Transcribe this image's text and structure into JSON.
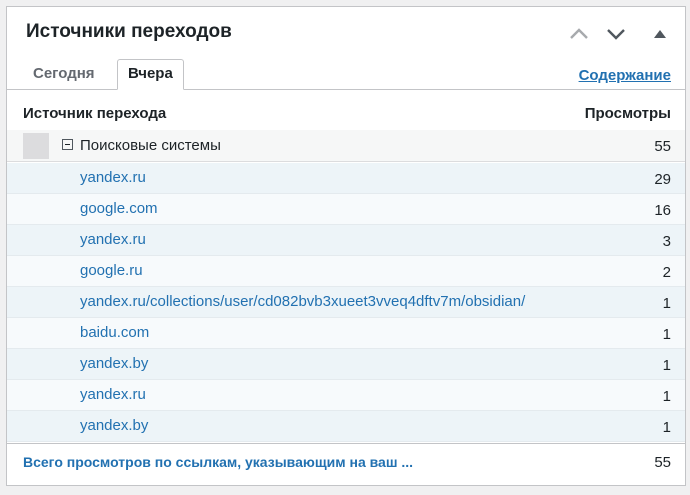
{
  "widget": {
    "title": "Источники переходов",
    "controls": {
      "up_icon": "chevron-up-icon",
      "down_icon": "chevron-down-icon",
      "collapse_icon": "triangle-up-icon"
    }
  },
  "tabs": {
    "today": "Сегодня",
    "yesterday": "Вчера",
    "active": "yesterday"
  },
  "contents_link": "Содержание",
  "table": {
    "columns": {
      "source": "Источник перехода",
      "views": "Просмотры"
    },
    "group": {
      "label": "Поисковые системы",
      "count": "55",
      "toggle_icon": "minus-box-icon"
    },
    "rows": [
      {
        "url": "yandex.ru",
        "count": "29"
      },
      {
        "url": "google.com",
        "count": "16"
      },
      {
        "url": "yandex.ru",
        "count": "3"
      },
      {
        "url": "google.ru",
        "count": "2"
      },
      {
        "url": "yandex.ru/collections/user/cd082bvb3xueet3vveq4dftv7m/obsidian/",
        "count": "1"
      },
      {
        "url": "baidu.com",
        "count": "1"
      },
      {
        "url": "yandex.by",
        "count": "1"
      },
      {
        "url": "yandex.ru",
        "count": "1"
      },
      {
        "url": "yandex.by",
        "count": "1"
      }
    ]
  },
  "footer": {
    "total_label": "Всего просмотров по ссылкам, указывающим на ваш ...",
    "total_value": "55"
  },
  "colors": {
    "link": "#2271b1",
    "text": "#1d2327",
    "muted": "#646970",
    "row_odd": "#edf4f8",
    "row_even": "#f7fafc"
  }
}
